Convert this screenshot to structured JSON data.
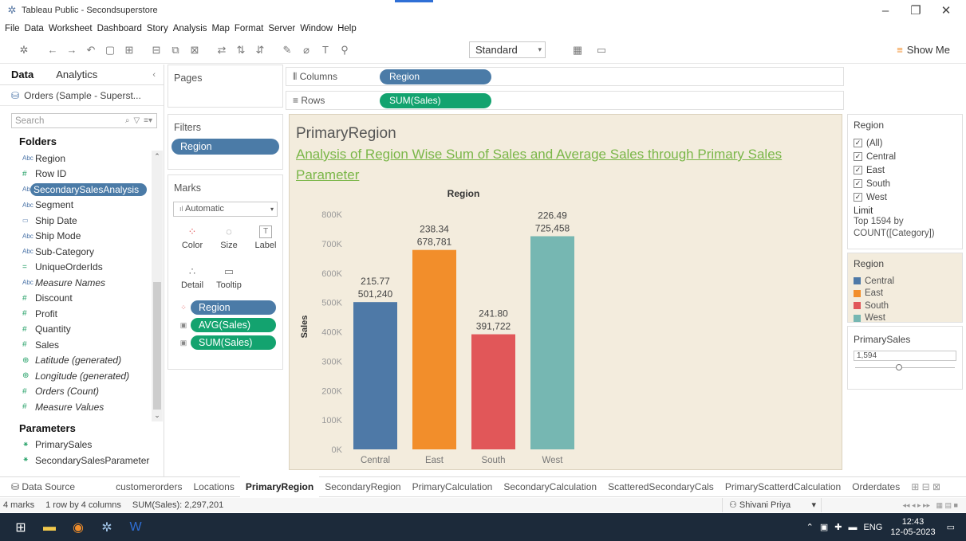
{
  "window": {
    "title": "Tableau Public - Secondsuperstore"
  },
  "menu": [
    "File",
    "Data",
    "Worksheet",
    "Dashboard",
    "Story",
    "Analysis",
    "Map",
    "Format",
    "Server",
    "Window",
    "Help"
  ],
  "toolbar": {
    "fit_value": "Standard",
    "show_me": "Show Me"
  },
  "datapane": {
    "tabs": [
      "Data",
      "Analytics"
    ],
    "datasource": "Orders (Sample - Superst...",
    "search_placeholder": "Search",
    "folders_header": "Folders",
    "fields": [
      {
        "label": "Region",
        "type": "dim"
      },
      {
        "label": "Row ID",
        "type": "measure"
      },
      {
        "label": "SecondarySalesAnalysis",
        "type": "dim",
        "highlight": true
      },
      {
        "label": "Segment",
        "type": "dim"
      },
      {
        "label": "Ship Date",
        "type": "date"
      },
      {
        "label": "Ship Mode",
        "type": "dim"
      },
      {
        "label": "Sub-Category",
        "type": "dim"
      },
      {
        "label": "UniqueOrderIds",
        "type": "calc"
      },
      {
        "label": "Measure Names",
        "type": "dim",
        "italic": true
      },
      {
        "label": "Discount",
        "type": "measure"
      },
      {
        "label": "Profit",
        "type": "measure"
      },
      {
        "label": "Quantity",
        "type": "measure"
      },
      {
        "label": "Sales",
        "type": "measure"
      },
      {
        "label": "Latitude (generated)",
        "type": "geo",
        "italic": true
      },
      {
        "label": "Longitude (generated)",
        "type": "geo",
        "italic": true
      },
      {
        "label": "Orders (Count)",
        "type": "measure",
        "italic": true
      },
      {
        "label": "Measure Values",
        "type": "measure",
        "italic": true
      }
    ],
    "parameters_header": "Parameters",
    "parameters": [
      "PrimarySales",
      "SecondarySalesParameter"
    ]
  },
  "shelves": {
    "pages_label": "Pages",
    "filters_label": "Filters",
    "filter_pill": "Region",
    "marks_label": "Marks",
    "marks_type": "Automatic",
    "mark_buttons": [
      "Color",
      "Size",
      "Label",
      "Detail",
      "Tooltip"
    ],
    "mark_pills": [
      "Region",
      "AVG(Sales)",
      "SUM(Sales)"
    ],
    "columns_label": "Columns",
    "columns_pill": "Region",
    "rows_label": "Rows",
    "rows_pill": "SUM(Sales)"
  },
  "viz": {
    "title": "PrimaryRegion",
    "subtitle": "Analysis of  Region Wise Sum of Sales  and Average Sales through Primary Sales Parameter"
  },
  "chart_data": {
    "type": "bar",
    "title": "Region",
    "xlabel": "",
    "ylabel": "Sales",
    "categories": [
      "Central",
      "East",
      "South",
      "West"
    ],
    "series": [
      {
        "name": "SUM(Sales)",
        "values": [
          501240,
          678781,
          391722,
          725458
        ]
      },
      {
        "name": "AVG(Sales)",
        "values": [
          215.77,
          238.34,
          241.8,
          226.49
        ]
      }
    ],
    "bar_labels": [
      [
        "215.77",
        "501,240"
      ],
      [
        "238.34",
        "678,781"
      ],
      [
        "241.80",
        "391,722"
      ],
      [
        "226.49",
        "725,458"
      ]
    ],
    "colors": [
      "#4e79a7",
      "#f28e2b",
      "#e15759",
      "#76b7b2"
    ],
    "ylim": [
      0,
      800000
    ],
    "yticks": [
      "0K",
      "100K",
      "200K",
      "300K",
      "400K",
      "500K",
      "600K",
      "700K",
      "800K"
    ],
    "grid": false
  },
  "filter_card": {
    "title": "Region",
    "options": [
      "(All)",
      "Central",
      "East",
      "South",
      "West"
    ],
    "limit_header": "Limit",
    "limit_text": [
      "Top 1594 by",
      "COUNT([Category])"
    ]
  },
  "legend": {
    "title": "Region",
    "items": [
      {
        "label": "Central",
        "color": "#4e79a7"
      },
      {
        "label": "East",
        "color": "#f28e2b"
      },
      {
        "label": "South",
        "color": "#e15759"
      },
      {
        "label": "West",
        "color": "#76b7b2"
      }
    ]
  },
  "parameter_card": {
    "title": "PrimarySales",
    "value": "1,594"
  },
  "sheet_tabs": [
    "Data Source",
    "customerorders",
    "Locations",
    "PrimaryRegion",
    "SecondaryRegion",
    "PrimaryCalculation",
    "SecondaryCalculation",
    "ScatteredSecondaryCals",
    "PrimaryScatterdCalculation",
    "Orderdates"
  ],
  "active_sheet": "PrimaryRegion",
  "status": {
    "marks": "4 marks",
    "layout": "1 row by 4 columns",
    "sum": "SUM(Sales): 2,297,201",
    "user": "Shivani Priya"
  },
  "taskbar": {
    "lang": "ENG",
    "time": "12:43",
    "date": "12-05-2023"
  }
}
